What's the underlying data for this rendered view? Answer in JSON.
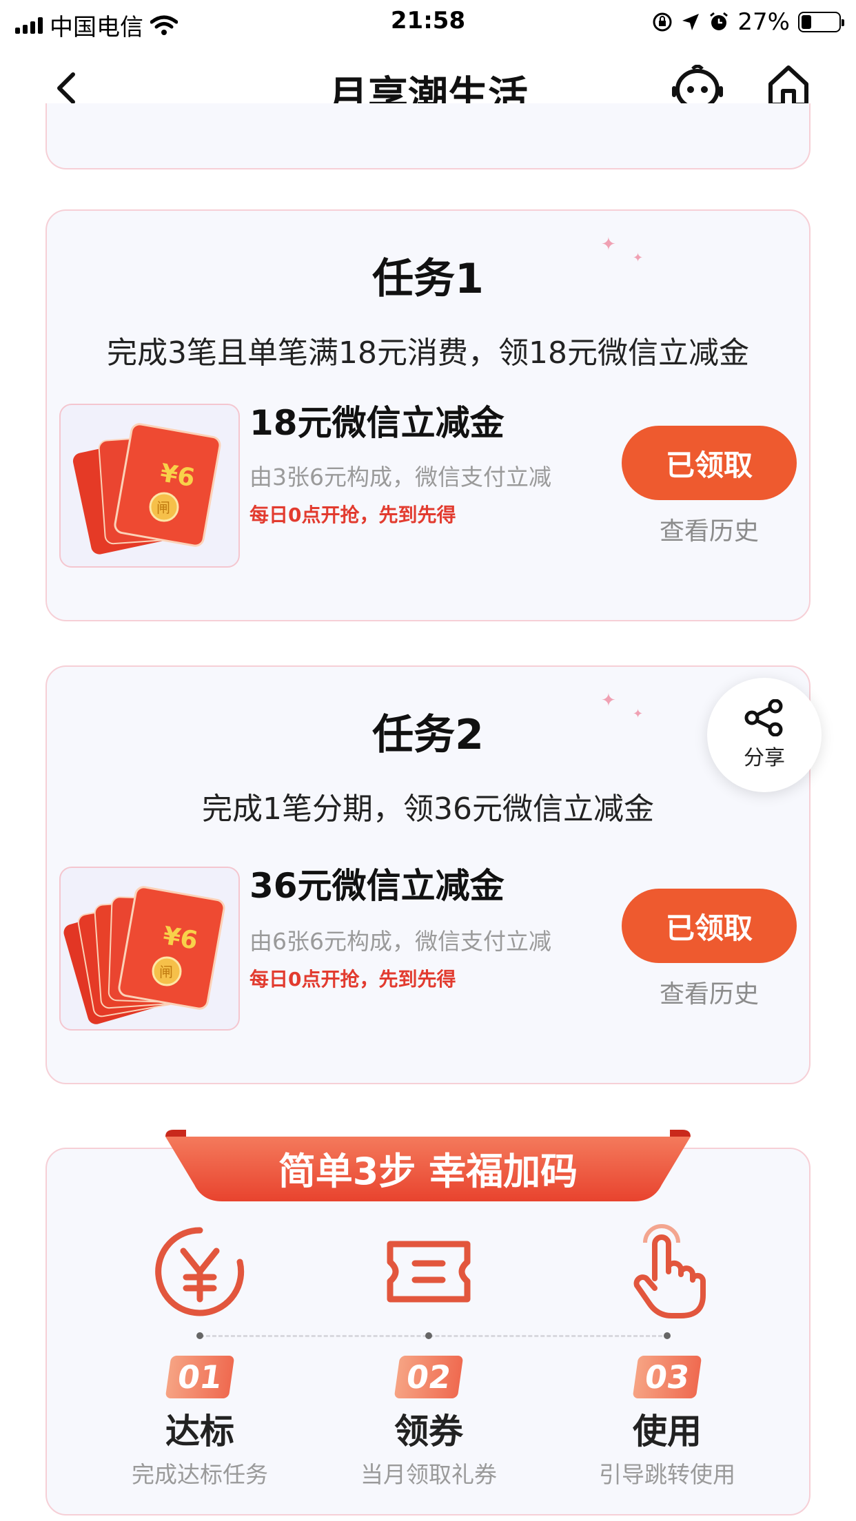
{
  "status_bar": {
    "carrier": "中国电信",
    "time": "21:58",
    "battery": "27%"
  },
  "nav": {
    "title": "月享潮生活"
  },
  "tasks": [
    {
      "title": "任务1",
      "desc": "完成3笔且单笔满18元消费，领18元微信立减金",
      "prize": "18元微信立减金",
      "sub": "由3张6元构成，微信支付立减",
      "hint": "每日0点开抢，先到先得",
      "button": "已领取",
      "history": "查看历史",
      "envelope_amount": "¥6",
      "envelope_seal": "闸"
    },
    {
      "title": "任务2",
      "desc": "完成1笔分期，领36元微信立减金",
      "prize": "36元微信立减金",
      "sub": "由6张6元构成，微信支付立减",
      "hint": "每日0点开抢，先到先得",
      "button": "已领取",
      "history": "查看历史",
      "envelope_amount": "¥6",
      "envelope_seal": "闸"
    }
  ],
  "share": {
    "label": "分享"
  },
  "steps_section": {
    "banner": "简单3步 幸福加码",
    "steps": [
      {
        "num": "01",
        "title": "达标",
        "sub": "完成达标任务",
        "icon": "yen-coin-icon"
      },
      {
        "num": "02",
        "title": "领券",
        "sub": "当月领取礼券",
        "icon": "ticket-icon"
      },
      {
        "num": "03",
        "title": "使用",
        "sub": "引导跳转使用",
        "icon": "tap-hand-icon"
      }
    ]
  },
  "colors": {
    "accent": "#ee5a2f",
    "card_border": "#f6cfd6",
    "hint_red": "#e23b2f"
  }
}
